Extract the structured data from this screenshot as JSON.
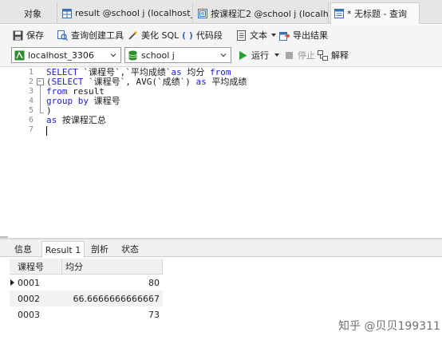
{
  "tabs": [
    {
      "label": "对象"
    },
    {
      "label": "result @school j (localhost_..."
    },
    {
      "label": "按课程汇2 @school j (localh..."
    },
    {
      "label": "* 无标题 - 查询"
    }
  ],
  "toolbar": {
    "save": "保存",
    "query_builder": "查询创建工具",
    "beautify": "美化 SQL",
    "snippet": "代码段",
    "text": "文本",
    "export": "导出结果"
  },
  "toolbar2": {
    "connection": "localhost_3306",
    "database": "school j",
    "run": "运行",
    "stop": "停止",
    "explain": "解释"
  },
  "editor": {
    "line_numbers": [
      "1",
      "2",
      "3",
      "4",
      "5",
      "6",
      "7"
    ],
    "lines": [
      [
        {
          "t": "kw",
          "v": "SELECT "
        },
        {
          "t": "txt",
          "v": "`课程号`,`平均成绩`"
        },
        {
          "t": "kw",
          "v": "as "
        },
        {
          "t": "txt",
          "v": "均分 "
        },
        {
          "t": "kw",
          "v": "from"
        }
      ],
      [
        {
          "t": "txt",
          "v": "("
        },
        {
          "t": "kw",
          "v": "SELECT "
        },
        {
          "t": "txt",
          "v": "`课程号`, AVG(`成绩`) "
        },
        {
          "t": "kw",
          "v": "as "
        },
        {
          "t": "txt",
          "v": "平均成绩"
        }
      ],
      [
        {
          "t": "kw",
          "v": "from "
        },
        {
          "t": "txt",
          "v": "result"
        }
      ],
      [
        {
          "t": "kw",
          "v": "group by "
        },
        {
          "t": "txt",
          "v": "课程号"
        }
      ],
      [
        {
          "t": "txt",
          "v": ")"
        }
      ],
      [
        {
          "t": "kw",
          "v": "as "
        },
        {
          "t": "txt",
          "v": "按课程汇总"
        }
      ],
      []
    ]
  },
  "result_tabs": [
    "信息",
    "Result 1",
    "剖析",
    "状态"
  ],
  "table": {
    "columns": [
      "课程号",
      "均分"
    ],
    "rows": [
      [
        "0001",
        "80"
      ],
      [
        "0002",
        "66.6666666666667"
      ],
      [
        "0003",
        "73"
      ]
    ]
  },
  "watermark": "知乎 @贝贝199311",
  "colors": {
    "keyword": "#1a1ad6",
    "run": "#27a033",
    "db": "#2e8b2e"
  }
}
